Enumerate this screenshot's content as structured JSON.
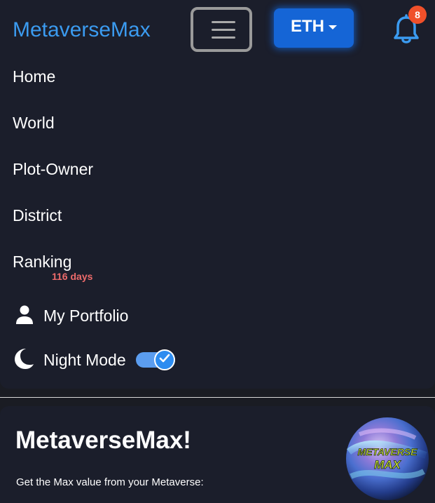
{
  "header": {
    "brand": "MetaverseMax",
    "network_label": "ETH",
    "notification_count": "8"
  },
  "menu": {
    "items": [
      {
        "label": "Home"
      },
      {
        "label": "World"
      },
      {
        "label": "Plot-Owner"
      },
      {
        "label": "District"
      },
      {
        "label": "Ranking"
      }
    ],
    "ranking_badge": "116 days",
    "portfolio_label": "My Portfolio",
    "night_mode_label": "Night Mode",
    "night_mode_on": true
  },
  "hero": {
    "title": "MetaverseMax!",
    "subtitle": "Get the Max value from your Metaverse:",
    "logo_text_line1": "METAVERSE",
    "logo_text_line2": "MAX"
  },
  "colors": {
    "accent": "#3b9bf0",
    "button": "#1565d6",
    "badge": "#f0502a",
    "days_badge": "#ee6b6b",
    "background": "#1a1c23",
    "card": "#1b1e2b"
  },
  "icons": {
    "menu": "hamburger-icon",
    "notifications": "bell-icon",
    "portfolio": "user-icon",
    "night_mode": "moon-icon",
    "toggle_state": "check-icon"
  }
}
